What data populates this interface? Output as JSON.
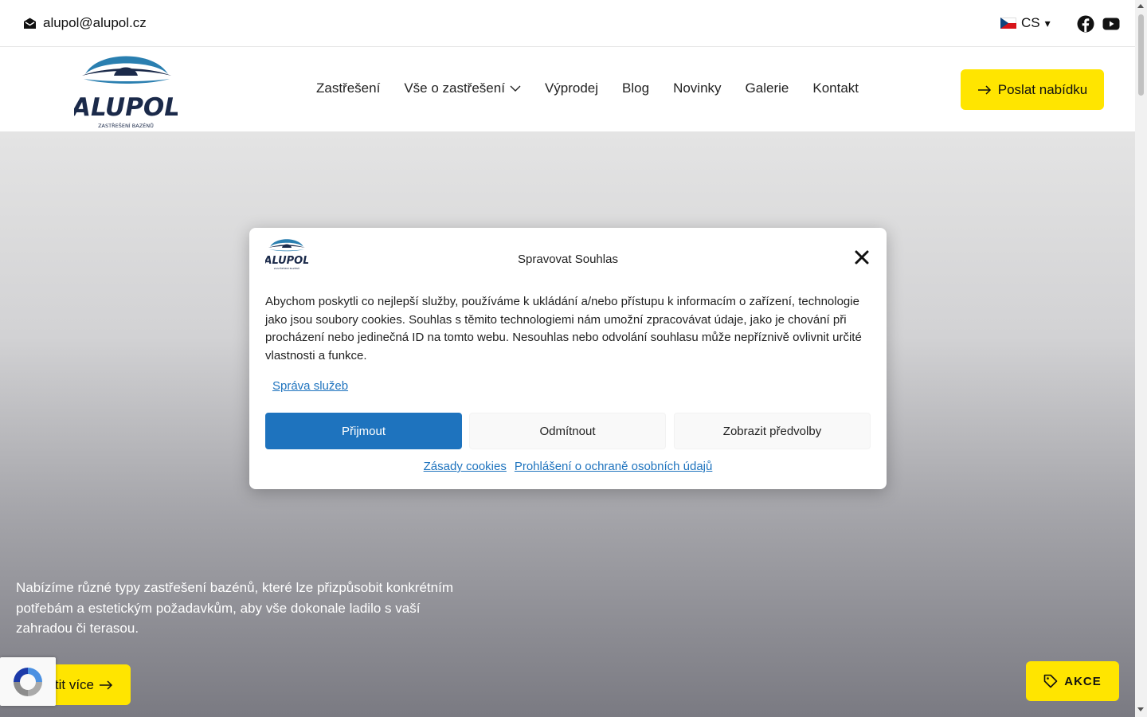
{
  "topbar": {
    "email": "alupol@alupol.cz",
    "language": "CS",
    "language_caret": "▾"
  },
  "header": {
    "logo_text": "ALUPOL",
    "logo_subtext": "ZASTŘEŠENÍ BAZÉNŮ",
    "nav": [
      {
        "label": "Zastřešení"
      },
      {
        "label": "Vše o zastřešení"
      },
      {
        "label": "Výprodej"
      },
      {
        "label": "Blog"
      },
      {
        "label": "Novinky"
      },
      {
        "label": "Galerie"
      },
      {
        "label": "Kontakt"
      }
    ],
    "cta_label": "Poslat nabídku"
  },
  "hero": {
    "text": "Nabízíme různé typy zastřešení bazénů, které lze přizpůsobit konkrétním potřebám a estetickým požadavkům, aby vše dokonale ladilo s vaší zahradou či terasou.",
    "button_label": "tit více",
    "akce_label": "AKCE"
  },
  "modal": {
    "title": "Spravovat Souhlas",
    "body": "Abychom poskytli co nejlepší služby, používáme k ukládání a/nebo přístupu k informacím o zařízení, technologie jako jsou soubory cookies. Souhlas s těmito technologiemi nám umožní zpracovávat údaje, jako je chování při procházení nebo jedinečná ID na tomto webu. Nesouhlas nebo odvolání souhlasu může nepříznivě ovlivnit určité vlastnosti a funkce.",
    "manage_link": "Správa služeb",
    "accept_label": "Přijmout",
    "deny_label": "Odmítnout",
    "prefs_label": "Zobrazit předvolby",
    "footer_links": [
      "Zásady cookies",
      "Prohlášení o ochraně osobních údajů"
    ]
  },
  "colors": {
    "accent_yellow": "#ffe500",
    "primary_blue": "#1e73be",
    "logo_navy": "#1b2a4a",
    "logo_teal": "#2a7fb0"
  },
  "icons": [
    "envelope-icon",
    "czech-flag-icon",
    "facebook-icon",
    "youtube-icon",
    "chevron-down-icon",
    "arrow-right-icon",
    "close-icon",
    "tag-icon",
    "recaptcha-icon"
  ]
}
